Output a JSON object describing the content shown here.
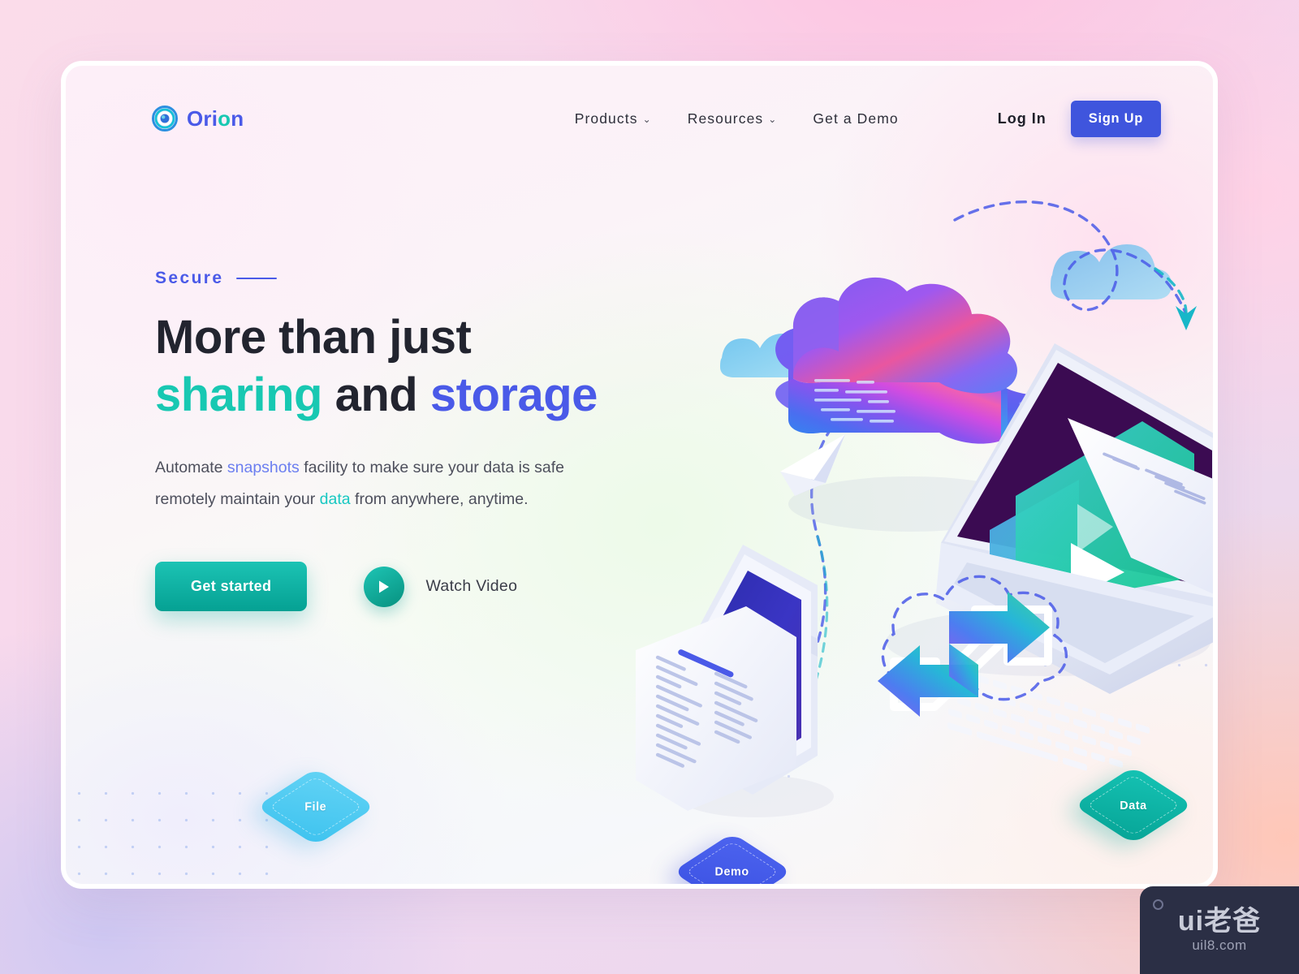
{
  "brand": {
    "name": "Orion",
    "name_part1": "Ori",
    "name_dot": "o",
    "name_part2": "n",
    "logo_icon": "concentric-circle-icon",
    "accent_blue": "#4a5ae8",
    "accent_teal": "#18c8b2"
  },
  "nav": {
    "items": [
      {
        "label": "Products",
        "has_chevron": true,
        "chevron": "⌄"
      },
      {
        "label": "Resources",
        "has_chevron": true,
        "chevron": "⌄"
      },
      {
        "label": "Get a Demo",
        "has_chevron": false,
        "chevron": ""
      }
    ],
    "login_label": "Log In",
    "signup_label": "Sign Up",
    "signup_color": "#3f55dd"
  },
  "hero": {
    "eyebrow": "Secure",
    "headline_line1": "More than just",
    "headline_word_sharing": "sharing",
    "headline_word_and": "and",
    "headline_word_storage": "storage",
    "sub_part1": "Automate ",
    "sub_link1": "snapshots",
    "sub_part2": " facility to make sure your data is safe remotely maintain your ",
    "sub_link2": "data",
    "sub_part3": " from anywhere, anytime.",
    "primary_cta": "Get started",
    "secondary_cta": "Watch Video",
    "primary_cta_color": "#0fb3a3",
    "play_icon": "play-icon"
  },
  "illustration": {
    "tiles": [
      {
        "label": "File",
        "color": "#47c6ef"
      },
      {
        "label": "Demo",
        "color": "#4257ea"
      },
      {
        "label": "Data",
        "color": "#0db3a5"
      }
    ],
    "objects": [
      "isometric-cloud-3d",
      "isometric-laptop",
      "isometric-phone",
      "document-page",
      "paper-plane",
      "sync-arrows",
      "flat-cloud-small",
      "flat-cloud-large",
      "dashed-path"
    ]
  },
  "watermark": {
    "main": "ui老爸",
    "sub": "uil8.com"
  }
}
